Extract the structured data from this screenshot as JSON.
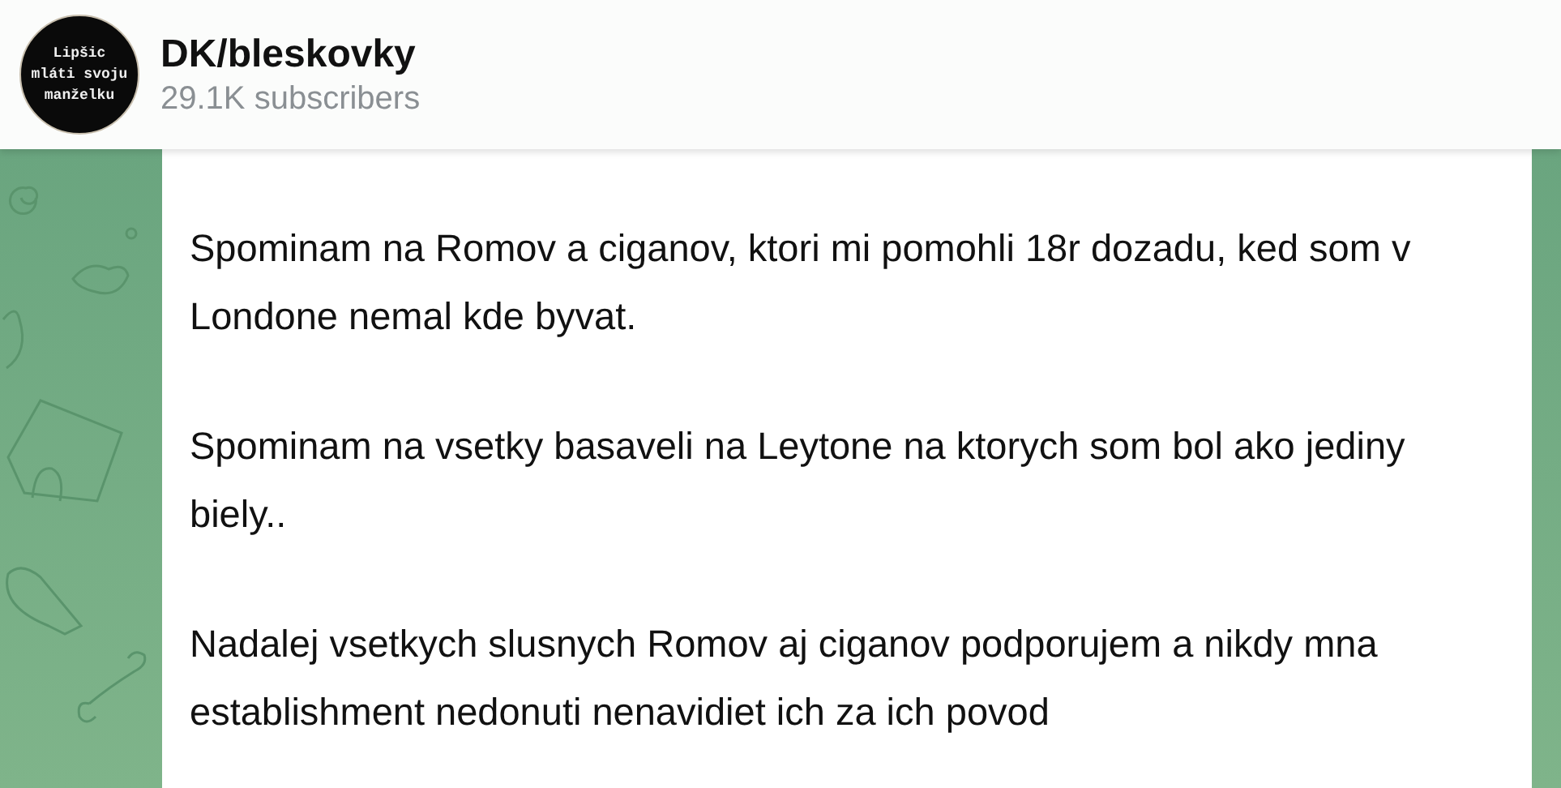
{
  "channel": {
    "avatar_lines": [
      "Lipšic",
      "mláti svoju",
      "manželku"
    ],
    "title": "DK/bleskovky",
    "subscribers": "29.1K subscribers"
  },
  "message": {
    "paragraphs": [
      "Spominam na Romov a ciganov, ktori mi pomohli 18r dozadu, ked som v Londone nemal kde byvat.",
      "Spominam na vsetky basaveli na Leytone na ktorych som bol ako jediny biely..",
      "Nadalej vsetkych slusnych Romov aj ciganov podporujem a nikdy mna establishment nedonuti nenavidiet ich za ich povod"
    ]
  }
}
